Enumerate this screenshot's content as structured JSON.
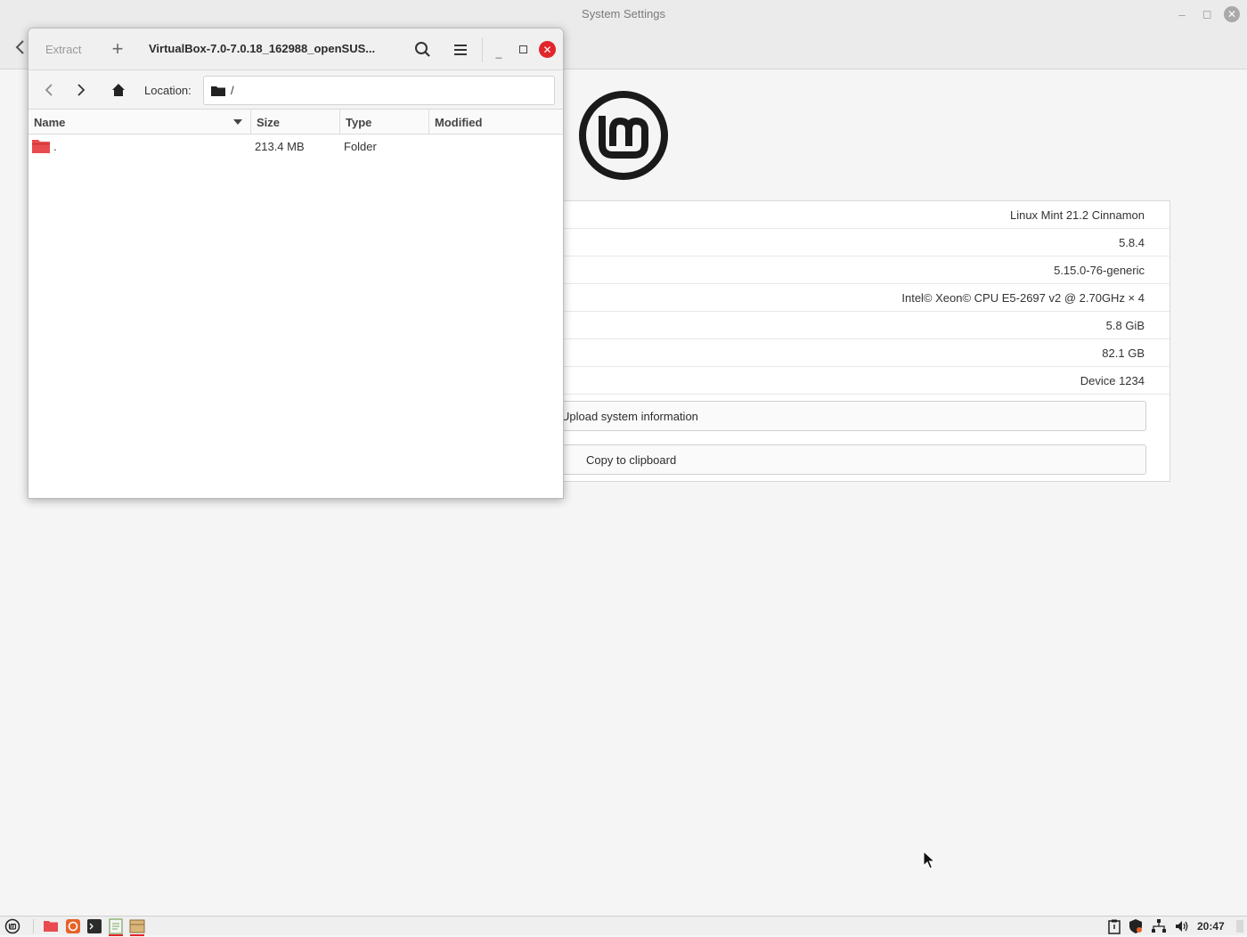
{
  "system_settings": {
    "title": "System Settings",
    "window_controls": {
      "minimize": "–",
      "maximize": "◻",
      "close": "✕"
    },
    "back": "‹",
    "info_values": [
      "Linux Mint 21.2 Cinnamon",
      "5.8.4",
      "5.15.0-76-generic",
      "Intel© Xeon© CPU E5-2697 v2 @ 2.70GHz × 4",
      "5.8 GiB",
      "82.1 GB",
      "Device 1234"
    ],
    "upload_label": "Upload system information",
    "copy_label": "Copy to clipboard"
  },
  "archive": {
    "extract_label": "Extract",
    "add_label": "+",
    "title": "VirtualBox-7.0-7.0.18_162988_openSUS...",
    "location_label": "Location:",
    "location_value": "/",
    "columns": {
      "name": "Name",
      "size": "Size",
      "type": "Type",
      "modified": "Modified"
    },
    "rows": [
      {
        "name": ".",
        "size": "213.4 MB",
        "type": "Folder",
        "modified": ""
      }
    ],
    "window_controls": {
      "minimize": "_",
      "close": "✕"
    }
  },
  "taskbar": {
    "clock": "20:47",
    "icons": [
      "menu-icon",
      "files-icon",
      "firefox-icon",
      "terminal-icon",
      "text-editor-icon",
      "archive-manager-icon"
    ],
    "tray_icons": [
      "clipboard-icon",
      "shield-icon",
      "network-icon",
      "volume-icon"
    ]
  },
  "colors": {
    "accent_red": "#e0252b",
    "background": "#f5f5f5",
    "folder_red": "#e84a4f"
  }
}
